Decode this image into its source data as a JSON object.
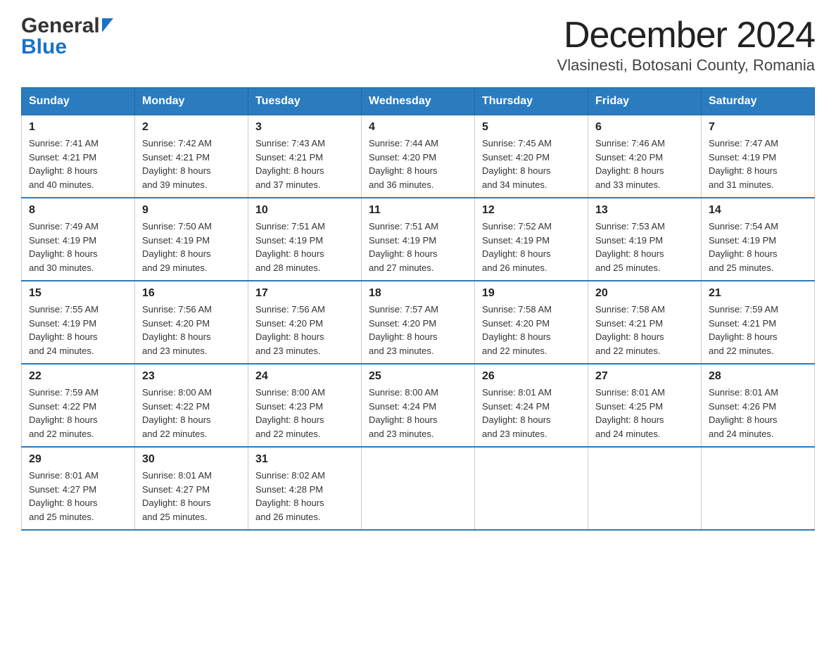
{
  "header": {
    "title": "December 2024",
    "subtitle": "Vlasinesti, Botosani County, Romania",
    "logo_general": "General",
    "logo_blue": "Blue"
  },
  "calendar": {
    "days_of_week": [
      "Sunday",
      "Monday",
      "Tuesday",
      "Wednesday",
      "Thursday",
      "Friday",
      "Saturday"
    ],
    "weeks": [
      {
        "days": [
          {
            "num": "1",
            "sunrise": "Sunrise: 7:41 AM",
            "sunset": "Sunset: 4:21 PM",
            "daylight": "Daylight: 8 hours",
            "daylight2": "and 40 minutes."
          },
          {
            "num": "2",
            "sunrise": "Sunrise: 7:42 AM",
            "sunset": "Sunset: 4:21 PM",
            "daylight": "Daylight: 8 hours",
            "daylight2": "and 39 minutes."
          },
          {
            "num": "3",
            "sunrise": "Sunrise: 7:43 AM",
            "sunset": "Sunset: 4:21 PM",
            "daylight": "Daylight: 8 hours",
            "daylight2": "and 37 minutes."
          },
          {
            "num": "4",
            "sunrise": "Sunrise: 7:44 AM",
            "sunset": "Sunset: 4:20 PM",
            "daylight": "Daylight: 8 hours",
            "daylight2": "and 36 minutes."
          },
          {
            "num": "5",
            "sunrise": "Sunrise: 7:45 AM",
            "sunset": "Sunset: 4:20 PM",
            "daylight": "Daylight: 8 hours",
            "daylight2": "and 34 minutes."
          },
          {
            "num": "6",
            "sunrise": "Sunrise: 7:46 AM",
            "sunset": "Sunset: 4:20 PM",
            "daylight": "Daylight: 8 hours",
            "daylight2": "and 33 minutes."
          },
          {
            "num": "7",
            "sunrise": "Sunrise: 7:47 AM",
            "sunset": "Sunset: 4:19 PM",
            "daylight": "Daylight: 8 hours",
            "daylight2": "and 31 minutes."
          }
        ]
      },
      {
        "days": [
          {
            "num": "8",
            "sunrise": "Sunrise: 7:49 AM",
            "sunset": "Sunset: 4:19 PM",
            "daylight": "Daylight: 8 hours",
            "daylight2": "and 30 minutes."
          },
          {
            "num": "9",
            "sunrise": "Sunrise: 7:50 AM",
            "sunset": "Sunset: 4:19 PM",
            "daylight": "Daylight: 8 hours",
            "daylight2": "and 29 minutes."
          },
          {
            "num": "10",
            "sunrise": "Sunrise: 7:51 AM",
            "sunset": "Sunset: 4:19 PM",
            "daylight": "Daylight: 8 hours",
            "daylight2": "and 28 minutes."
          },
          {
            "num": "11",
            "sunrise": "Sunrise: 7:51 AM",
            "sunset": "Sunset: 4:19 PM",
            "daylight": "Daylight: 8 hours",
            "daylight2": "and 27 minutes."
          },
          {
            "num": "12",
            "sunrise": "Sunrise: 7:52 AM",
            "sunset": "Sunset: 4:19 PM",
            "daylight": "Daylight: 8 hours",
            "daylight2": "and 26 minutes."
          },
          {
            "num": "13",
            "sunrise": "Sunrise: 7:53 AM",
            "sunset": "Sunset: 4:19 PM",
            "daylight": "Daylight: 8 hours",
            "daylight2": "and 25 minutes."
          },
          {
            "num": "14",
            "sunrise": "Sunrise: 7:54 AM",
            "sunset": "Sunset: 4:19 PM",
            "daylight": "Daylight: 8 hours",
            "daylight2": "and 25 minutes."
          }
        ]
      },
      {
        "days": [
          {
            "num": "15",
            "sunrise": "Sunrise: 7:55 AM",
            "sunset": "Sunset: 4:19 PM",
            "daylight": "Daylight: 8 hours",
            "daylight2": "and 24 minutes."
          },
          {
            "num": "16",
            "sunrise": "Sunrise: 7:56 AM",
            "sunset": "Sunset: 4:20 PM",
            "daylight": "Daylight: 8 hours",
            "daylight2": "and 23 minutes."
          },
          {
            "num": "17",
            "sunrise": "Sunrise: 7:56 AM",
            "sunset": "Sunset: 4:20 PM",
            "daylight": "Daylight: 8 hours",
            "daylight2": "and 23 minutes."
          },
          {
            "num": "18",
            "sunrise": "Sunrise: 7:57 AM",
            "sunset": "Sunset: 4:20 PM",
            "daylight": "Daylight: 8 hours",
            "daylight2": "and 23 minutes."
          },
          {
            "num": "19",
            "sunrise": "Sunrise: 7:58 AM",
            "sunset": "Sunset: 4:20 PM",
            "daylight": "Daylight: 8 hours",
            "daylight2": "and 22 minutes."
          },
          {
            "num": "20",
            "sunrise": "Sunrise: 7:58 AM",
            "sunset": "Sunset: 4:21 PM",
            "daylight": "Daylight: 8 hours",
            "daylight2": "and 22 minutes."
          },
          {
            "num": "21",
            "sunrise": "Sunrise: 7:59 AM",
            "sunset": "Sunset: 4:21 PM",
            "daylight": "Daylight: 8 hours",
            "daylight2": "and 22 minutes."
          }
        ]
      },
      {
        "days": [
          {
            "num": "22",
            "sunrise": "Sunrise: 7:59 AM",
            "sunset": "Sunset: 4:22 PM",
            "daylight": "Daylight: 8 hours",
            "daylight2": "and 22 minutes."
          },
          {
            "num": "23",
            "sunrise": "Sunrise: 8:00 AM",
            "sunset": "Sunset: 4:22 PM",
            "daylight": "Daylight: 8 hours",
            "daylight2": "and 22 minutes."
          },
          {
            "num": "24",
            "sunrise": "Sunrise: 8:00 AM",
            "sunset": "Sunset: 4:23 PM",
            "daylight": "Daylight: 8 hours",
            "daylight2": "and 22 minutes."
          },
          {
            "num": "25",
            "sunrise": "Sunrise: 8:00 AM",
            "sunset": "Sunset: 4:24 PM",
            "daylight": "Daylight: 8 hours",
            "daylight2": "and 23 minutes."
          },
          {
            "num": "26",
            "sunrise": "Sunrise: 8:01 AM",
            "sunset": "Sunset: 4:24 PM",
            "daylight": "Daylight: 8 hours",
            "daylight2": "and 23 minutes."
          },
          {
            "num": "27",
            "sunrise": "Sunrise: 8:01 AM",
            "sunset": "Sunset: 4:25 PM",
            "daylight": "Daylight: 8 hours",
            "daylight2": "and 24 minutes."
          },
          {
            "num": "28",
            "sunrise": "Sunrise: 8:01 AM",
            "sunset": "Sunset: 4:26 PM",
            "daylight": "Daylight: 8 hours",
            "daylight2": "and 24 minutes."
          }
        ]
      },
      {
        "days": [
          {
            "num": "29",
            "sunrise": "Sunrise: 8:01 AM",
            "sunset": "Sunset: 4:27 PM",
            "daylight": "Daylight: 8 hours",
            "daylight2": "and 25 minutes."
          },
          {
            "num": "30",
            "sunrise": "Sunrise: 8:01 AM",
            "sunset": "Sunset: 4:27 PM",
            "daylight": "Daylight: 8 hours",
            "daylight2": "and 25 minutes."
          },
          {
            "num": "31",
            "sunrise": "Sunrise: 8:02 AM",
            "sunset": "Sunset: 4:28 PM",
            "daylight": "Daylight: 8 hours",
            "daylight2": "and 26 minutes."
          },
          null,
          null,
          null,
          null
        ]
      }
    ]
  }
}
